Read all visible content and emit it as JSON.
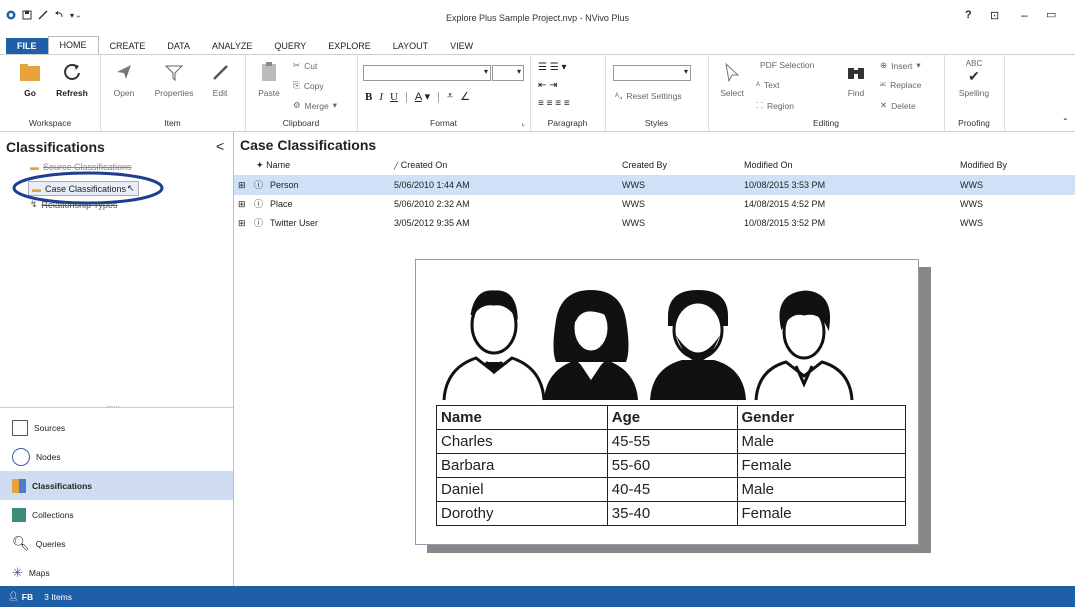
{
  "window": {
    "title": "Explore Plus Sample Project.nvp - NVivo Plus",
    "help": "?"
  },
  "tabs": [
    "FILE",
    "HOME",
    "CREATE",
    "DATA",
    "ANALYZE",
    "QUERY",
    "EXPLORE",
    "LAYOUT",
    "VIEW"
  ],
  "ribbon": {
    "workspace": {
      "go": "Go",
      "refresh": "Refresh",
      "label": "Workspace"
    },
    "item": {
      "open": "Open",
      "properties": "Properties",
      "edit": "Edit",
      "label": "Item"
    },
    "clipboard": {
      "paste": "Paste",
      "cut": "Cut",
      "copy": "Copy",
      "merge": "Merge",
      "label": "Clipboard"
    },
    "format": {
      "label": "Format"
    },
    "paragraph": {
      "label": "Paragraph"
    },
    "styles": {
      "reset": "Reset Settings",
      "label": "Styles"
    },
    "editing": {
      "select": "Select",
      "pdf_selection": "PDF Selection",
      "text": "Text",
      "region": "Region",
      "find": "Find",
      "insert": "Insert",
      "replace": "Replace",
      "delete": "Delete",
      "label": "Editing"
    },
    "proofing": {
      "spelling": "Spelling",
      "abc": "ABC",
      "label": "Proofing"
    }
  },
  "left_pane": {
    "title": "Classifications",
    "collapse": "<",
    "tree": [
      "Source Classifications",
      "Case Classifications",
      "Relationship Types"
    ],
    "nav": [
      "Sources",
      "Nodes",
      "Classifications",
      "Collections",
      "Queries",
      "Maps"
    ]
  },
  "main": {
    "title": "Case Classifications",
    "columns": [
      "Name",
      "Created On",
      "Created By",
      "Modified On",
      "Modified By"
    ],
    "rows": [
      [
        "Person",
        "5/06/2010 1:44 AM",
        "WWS",
        "10/08/2015 3:53 PM",
        "WWS"
      ],
      [
        "Place",
        "5/06/2010 2:32 AM",
        "WWS",
        "14/08/2015 4:52 PM",
        "WWS"
      ],
      [
        "Twitter User",
        "3/05/2012 9:35 AM",
        "WWS",
        "10/08/2015 3:52 PM",
        "WWS"
      ]
    ]
  },
  "people_table": {
    "header": [
      "Name",
      "Age",
      "Gender"
    ],
    "rows": [
      [
        "Charles",
        "45-55",
        "Male"
      ],
      [
        "Barbara",
        "55-60",
        "Female"
      ],
      [
        "Daniel",
        "40-45",
        "Male"
      ],
      [
        "Dorothy",
        "35-40",
        "Female"
      ]
    ]
  },
  "status": {
    "user": "FB",
    "items": "3 Items"
  },
  "colors": {
    "accent": "#1f5fa8",
    "selection": "#cfe1f7",
    "highlight_ring": "#1c3f8f"
  }
}
